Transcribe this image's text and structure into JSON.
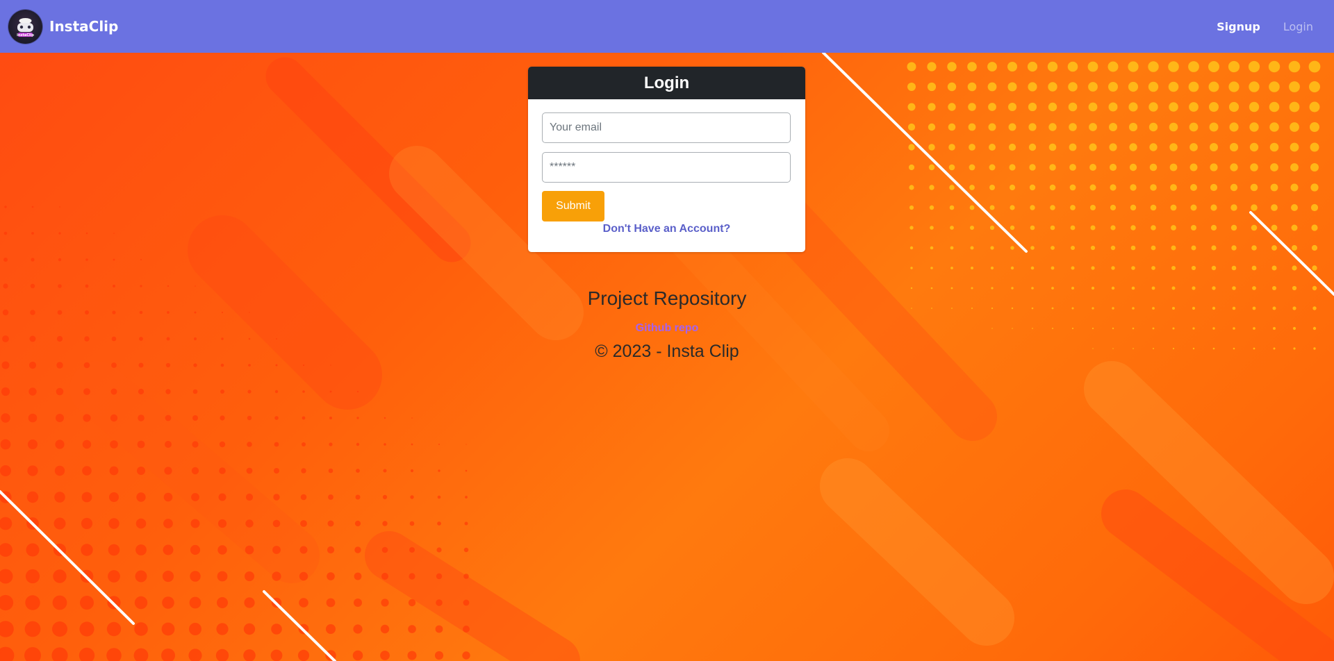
{
  "navbar": {
    "brand_name": "InstaClip",
    "logo_text": "InstaClip",
    "links": {
      "signup": "Signup",
      "login": "Login"
    }
  },
  "login_card": {
    "title": "Login",
    "email_placeholder": "Your email",
    "password_placeholder": "******",
    "submit_label": "Submit",
    "signup_prompt": "Don't Have an Account?"
  },
  "footer": {
    "title": "Project Repository",
    "repo_link": "Github repo",
    "copyright": "© 2023 - Insta Clip"
  },
  "colors": {
    "navbar": "#6b72e1",
    "card_header": "#212529",
    "submit": "#f8a008",
    "link": "#5a5fc9",
    "repo_link": "#a561f0"
  }
}
